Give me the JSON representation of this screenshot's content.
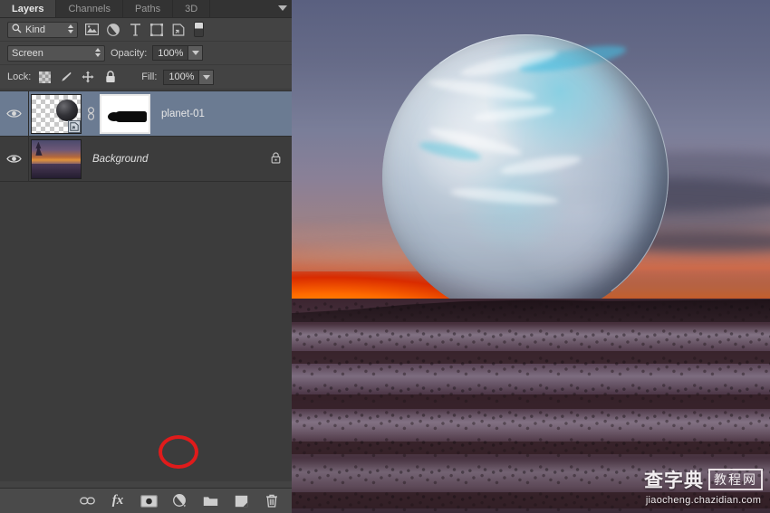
{
  "app": {
    "panel_title": "Layers"
  },
  "panel": {
    "tabs": [
      {
        "label": "Layers",
        "active": true
      },
      {
        "label": "Channels",
        "active": false
      },
      {
        "label": "Paths",
        "active": false
      },
      {
        "label": "3D",
        "active": false
      }
    ],
    "menu_icon": "panel-menu-icon",
    "filter": {
      "kind_label": "Kind",
      "search_icon": "search-icon",
      "icons": [
        "pixel-layer-filter-icon",
        "adjustment-layer-filter-icon",
        "type-layer-filter-icon",
        "shape-layer-filter-icon",
        "smart-object-filter-icon"
      ],
      "toggle_icon": "filter-toggle-switch"
    },
    "blend": {
      "mode": "Screen",
      "opacity_label": "Opacity:",
      "opacity_value": "100%"
    },
    "lock": {
      "label": "Lock:",
      "icons": [
        "lock-transparency-icon",
        "lock-image-pixels-icon",
        "lock-position-icon",
        "lock-all-icon"
      ],
      "fill_label": "Fill:",
      "fill_value": "100%"
    },
    "layers": [
      {
        "name": "planet-01",
        "visible": true,
        "selected": true,
        "has_mask": true,
        "linked": true,
        "smart_object": true,
        "locked": false,
        "thumb_kind": "transparent-sphere",
        "eye_icon": "eye-icon",
        "link_icon": "link-icon",
        "mask_icon": "layer-mask-thumbnail"
      },
      {
        "name": "Background",
        "visible": true,
        "selected": false,
        "has_mask": false,
        "linked": false,
        "smart_object": false,
        "locked": true,
        "thumb_kind": "landscape-photo",
        "eye_icon": "eye-icon",
        "lock_icon": "lock-icon"
      }
    ],
    "bottom_bar": {
      "buttons": [
        {
          "name": "link-layers-button",
          "icon": "link-icon",
          "label": ""
        },
        {
          "name": "layer-style-button",
          "icon": "fx-icon",
          "label": "fx"
        },
        {
          "name": "add-layer-mask-button",
          "icon": "add-mask-icon",
          "label": "",
          "highlighted": true
        },
        {
          "name": "adjustment-layer-button",
          "icon": "half-circle-icon",
          "label": ""
        },
        {
          "name": "new-group-button",
          "icon": "folder-icon",
          "label": ""
        },
        {
          "name": "new-layer-button",
          "icon": "new-layer-icon",
          "label": ""
        },
        {
          "name": "delete-layer-button",
          "icon": "trash-icon",
          "label": ""
        }
      ],
      "annotation": {
        "shape": "circle",
        "color": "#e01b1b",
        "targets": "add-layer-mask-button"
      }
    }
  },
  "canvas": {
    "description": "Composite of a large translucent planet over a snow covered canyon at sunset",
    "watermark": {
      "main": "查字典",
      "boxed": "教程网",
      "url": "jiaocheng.chazidian.com"
    }
  },
  "colors": {
    "panel_bg": "#434343",
    "tab_bg": "#333333",
    "selected_layer": "#6b7b92",
    "annotation_red": "#e01b1b",
    "text": "#c8c8c8"
  }
}
